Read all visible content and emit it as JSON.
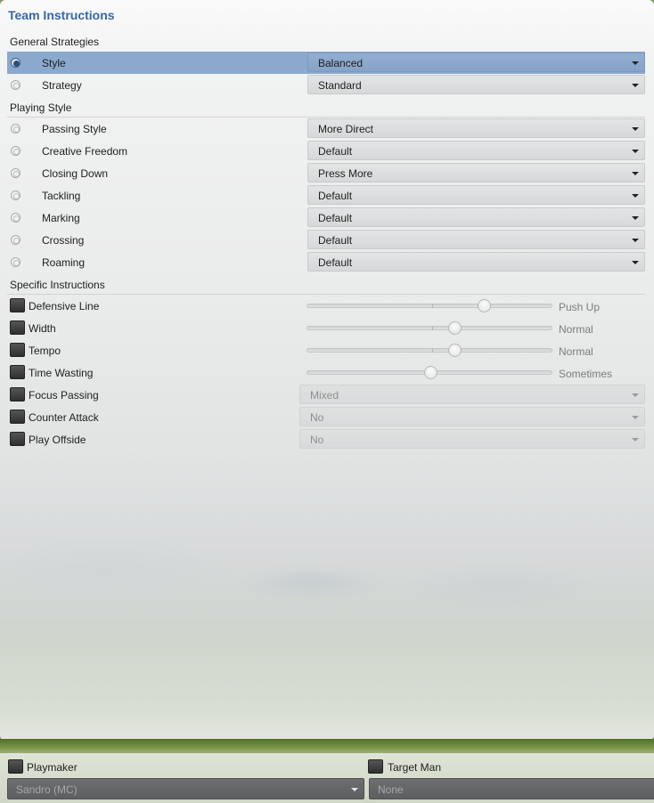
{
  "title": "Team Instructions",
  "sections": {
    "general": "General Strategies",
    "playing": "Playing Style",
    "specific": "Specific Instructions"
  },
  "general_rows": [
    {
      "label": "Style",
      "value": "Balanced",
      "selected": true
    },
    {
      "label": "Strategy",
      "value": "Standard",
      "selected": false
    }
  ],
  "playing_rows": [
    {
      "label": "Passing Style",
      "value": "More Direct"
    },
    {
      "label": "Creative Freedom",
      "value": "Default"
    },
    {
      "label": "Closing Down",
      "value": "Press More"
    },
    {
      "label": "Tackling",
      "value": "Default"
    },
    {
      "label": "Marking",
      "value": "Default"
    },
    {
      "label": "Crossing",
      "value": "Default"
    },
    {
      "label": "Roaming",
      "value": "Default"
    }
  ],
  "specific_sliders": [
    {
      "label": "Defensive Line",
      "value": "Push Up",
      "level": 0.72
    },
    {
      "label": "Width",
      "value": "Normal",
      "level": 0.6
    },
    {
      "label": "Tempo",
      "value": "Normal",
      "level": 0.6
    },
    {
      "label": "Time Wasting",
      "value": "Sometimes",
      "level": 0.5
    }
  ],
  "specific_selects": [
    {
      "label": "Focus Passing",
      "value": "Mixed"
    },
    {
      "label": "Counter Attack",
      "value": "No"
    },
    {
      "label": "Play Offside",
      "value": "No"
    }
  ],
  "bottom": {
    "playmaker_label": "Playmaker",
    "playmaker_value": "Sandro (MC)",
    "target_man_label": "Target Man",
    "target_man_value": "None"
  },
  "icons": {
    "radio": "radio-icon",
    "checkbox": "checkbox-icon",
    "caret": "chevron-down-icon"
  },
  "colors": {
    "title": "#3468a7",
    "selected_row": "#8aa9cc",
    "grass": "#6f8d42"
  }
}
